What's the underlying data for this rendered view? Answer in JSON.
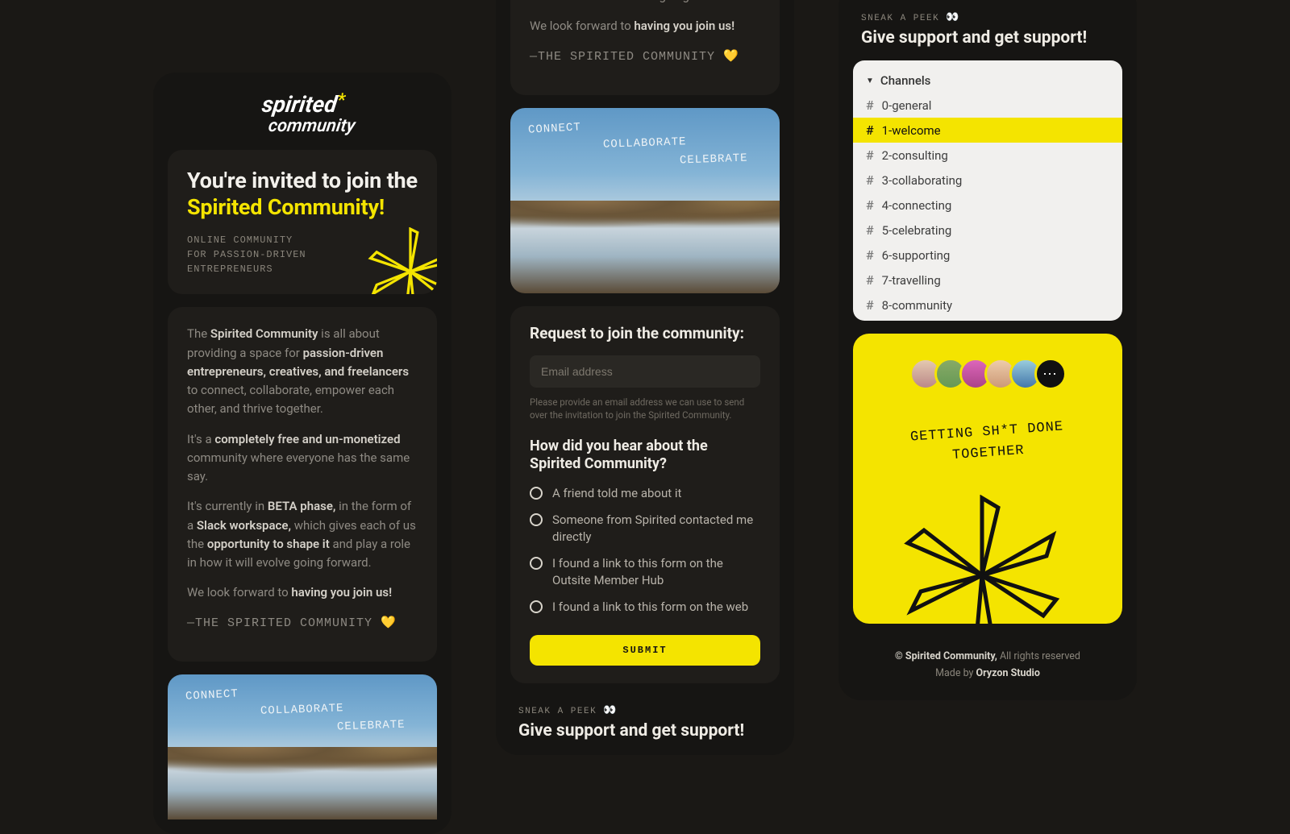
{
  "logo": {
    "line1": "spirited",
    "line2": "community",
    "asterisk": "*"
  },
  "hero_card": {
    "title_pre": "You're invited to join the ",
    "title_accent": "Spirited Community!",
    "sub_l1": "ONLINE COMMUNITY",
    "sub_l2": "FOR PASSION-DRIVEN",
    "sub_l3": "ENTREPRENEURS"
  },
  "body": {
    "p1a": "The ",
    "p1b": "Spirited Community",
    "p1c": " is all about providing a space for ",
    "p1d": "passion-driven entrepreneurs, creatives, and freelancers",
    "p1e": " to connect, collaborate, empower each other, and thrive together.",
    "p2a": "It's a ",
    "p2b": "completely free and un-monetized",
    "p2c": " community where everyone has the same say.",
    "p3a": "It's currently in ",
    "p3b": "BETA phase,",
    "p3c": " in the form of a ",
    "p3d": "Slack workspace,",
    "p3e": " which gives each of us the ",
    "p3f": "opportunity to shape it",
    "p3g": " and play a role in how it will evolve going forward.",
    "p4a": "We look forward to ",
    "p4b": "having you join us!",
    "signoff": "—THE SPIRITED COMMUNITY ",
    "heart": "💛"
  },
  "hero_words": {
    "w1": "CONNECT",
    "w2": "COLLABORATE",
    "w3": "CELEBRATE"
  },
  "tail": {
    "p3g": "role in how it will evolve going forward.",
    "p4a": "We look forward to ",
    "p4b": "having you join us!",
    "signoff": "—THE SPIRITED COMMUNITY ",
    "heart": "💛"
  },
  "form": {
    "title": "Request to join the community:",
    "placeholder": "Email address",
    "hint": "Please provide an email address we can use to send over the invitation to join the Spirited Community.",
    "question": "How did you hear about the Spirited Community?",
    "options": [
      "A friend told me about it",
      "Someone from Spirited contacted me directly",
      "I found a link to this form on the Outsite Member Hub",
      "I found a link to this form on the web"
    ],
    "submit": "SUBMIT"
  },
  "peek": {
    "label": "SNEAK A PEEK ",
    "eyes": "👀",
    "title": "Give support and get support!"
  },
  "channels": {
    "header": "Channels",
    "items": [
      "0-general",
      "1-welcome",
      "2-consulting",
      "3-collaborating",
      "4-connecting",
      "5-celebrating",
      "6-supporting",
      "7-travelling",
      "8-community"
    ],
    "active_index": 1
  },
  "slogan": {
    "l1": "GETTING SH*T DONE",
    "l2": "TOGETHER"
  },
  "footer": {
    "l1a": "© Spirited Community,",
    "l1b": " All rights reserved",
    "l2a": "Made by ",
    "l2b": "Oryzon Studio"
  }
}
